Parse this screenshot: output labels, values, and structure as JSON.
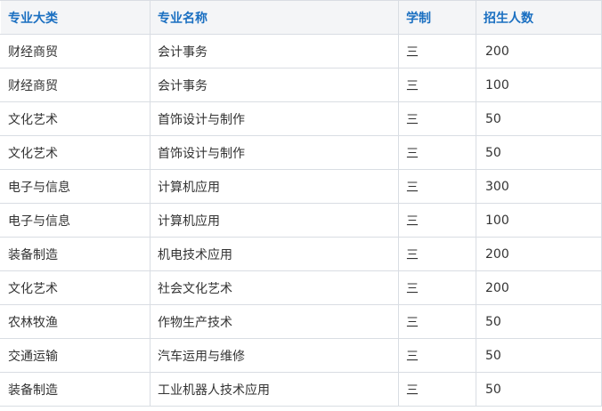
{
  "table": {
    "headers": [
      "专业大类",
      "专业名称",
      "学制",
      "招生人数"
    ],
    "rows": [
      [
        "财经商贸",
        "会计事务",
        "三",
        "200"
      ],
      [
        "财经商贸",
        "会计事务",
        "三",
        "100"
      ],
      [
        "文化艺术",
        "首饰设计与制作",
        "三",
        "50"
      ],
      [
        "文化艺术",
        "首饰设计与制作",
        "三",
        "50"
      ],
      [
        "电子与信息",
        "计算机应用",
        "三",
        "300"
      ],
      [
        "电子与信息",
        "计算机应用",
        "三",
        "100"
      ],
      [
        "装备制造",
        "机电技术应用",
        "三",
        "200"
      ],
      [
        "文化艺术",
        "社会文化艺术",
        "三",
        "200"
      ],
      [
        "农林牧渔",
        "作物生产技术",
        "三",
        "50"
      ],
      [
        "交通运输",
        "汽车运用与维修",
        "三",
        "50"
      ],
      [
        "装备制造",
        "工业机器人技术应用",
        "三",
        "50"
      ]
    ]
  },
  "colors": {
    "header_text": "#1a6fc1",
    "header_bg": "#f4f5f7",
    "border": "#d9dde3",
    "body_text": "#333333"
  }
}
